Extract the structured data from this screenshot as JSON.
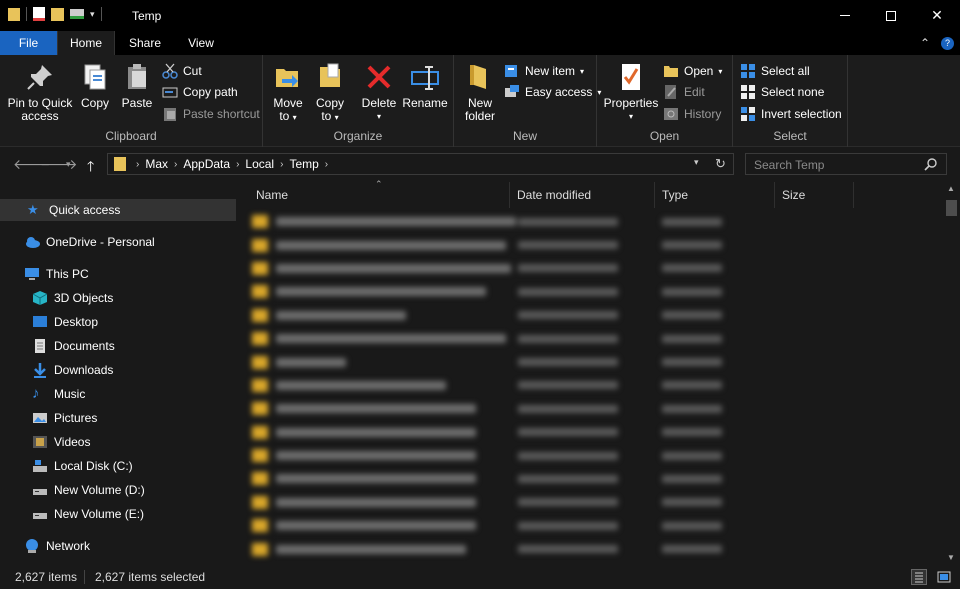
{
  "window": {
    "title": "Temp"
  },
  "tabs": {
    "file": "File",
    "home": "Home",
    "share": "Share",
    "view": "View"
  },
  "ribbon": {
    "clipboard": {
      "label": "Clipboard",
      "pin_line1": "Pin to Quick",
      "pin_line2": "access",
      "copy": "Copy",
      "paste": "Paste",
      "cut": "Cut",
      "copy_path": "Copy path",
      "paste_shortcut": "Paste shortcut"
    },
    "organize": {
      "label": "Organize",
      "move_to": "Move",
      "move_to2": "to",
      "copy_to": "Copy",
      "copy_to2": "to",
      "delete": "Delete",
      "rename": "Rename"
    },
    "new": {
      "label": "New",
      "new_folder1": "New",
      "new_folder2": "folder",
      "new_item": "New item",
      "easy_access": "Easy access"
    },
    "open": {
      "label": "Open",
      "properties": "Properties",
      "open": "Open",
      "edit": "Edit",
      "history": "History"
    },
    "select": {
      "label": "Select",
      "select_all": "Select all",
      "select_none": "Select none",
      "invert": "Invert selection"
    }
  },
  "address": {
    "crumbs": [
      "Max",
      "AppData",
      "Local",
      "Temp"
    ],
    "search_placeholder": "Search Temp"
  },
  "nav": {
    "quick_access": "Quick access",
    "onedrive": "OneDrive - Personal",
    "this_pc": "This PC",
    "items": [
      "3D Objects",
      "Desktop",
      "Documents",
      "Downloads",
      "Music",
      "Pictures",
      "Videos",
      "Local Disk (C:)",
      "New Volume (D:)",
      "New Volume (E:)"
    ],
    "network": "Network"
  },
  "columns": {
    "name": "Name",
    "date": "Date modified",
    "type": "Type",
    "size": "Size"
  },
  "status": {
    "count": "2,627 items",
    "selected": "2,627 items selected"
  },
  "colors": {
    "accent": "#1a64c0",
    "folder": "#d9a72a",
    "background": "#191919"
  }
}
